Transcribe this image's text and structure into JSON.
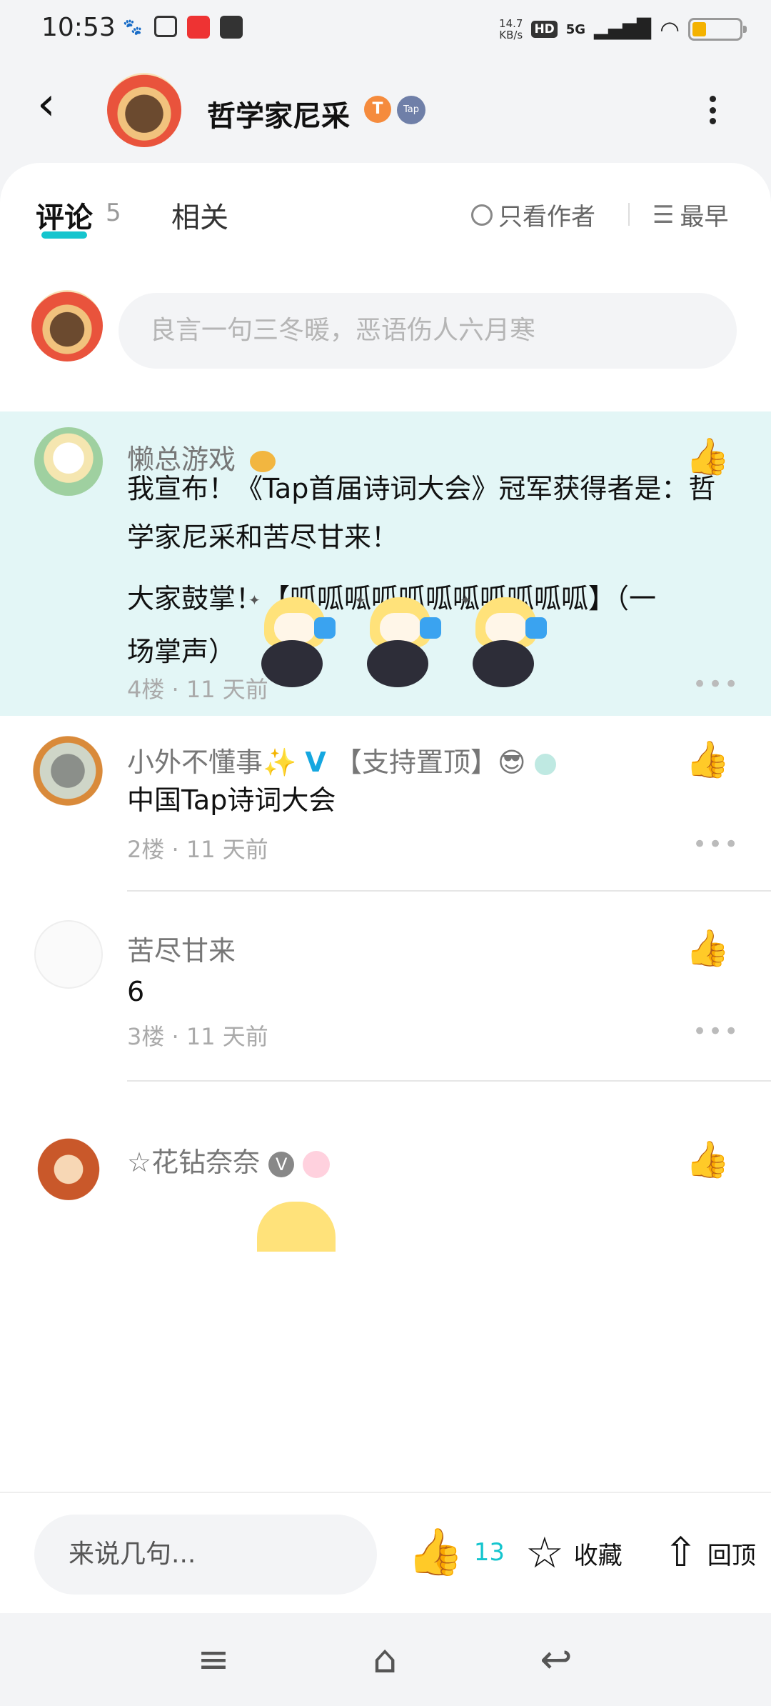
{
  "status_bar": {
    "time": "10:53",
    "net_speed_value": "14.7",
    "net_speed_unit": "KB/s",
    "hd": "HD",
    "signal": "5G",
    "app_icons": [
      "baidu-icon",
      "bilibili-icon",
      "news-app-icon",
      "mail-app-icon"
    ],
    "battery_level": 0.3
  },
  "header": {
    "title": "哲学家尼采",
    "badge1": "T",
    "badge2": "Tap"
  },
  "tabs": {
    "comments_label": "评论",
    "comments_count": "5",
    "related_label": "相关",
    "author_only_label": "只看作者",
    "sort_label": "最早"
  },
  "compose": {
    "placeholder": "良言一句三冬暖，恶语伤人六月寒"
  },
  "comments": [
    {
      "user": "懒总游戏",
      "text_line1": "我宣布！《Tap首届诗词大会》冠军获得者是：哲学家尼采和苦尽甘来！",
      "text_line2": "大家鼓掌！【呱呱呱呱呱呱呱呱呱呱呱】（一",
      "text_line3": "场掌声）",
      "floor": "4楼",
      "time": "11 天前"
    },
    {
      "user": "小外不懂事✨",
      "user_suffix": "【支持置顶】😎",
      "text": "中国Tap诗词大会",
      "floor": "2楼",
      "time": "11 天前"
    },
    {
      "user": "苦尽甘来",
      "text": "6",
      "floor": "3楼",
      "time": "11 天前"
    },
    {
      "user": "☆花钻奈奈"
    }
  ],
  "bottom_bar": {
    "input_placeholder": "来说几句...",
    "like_count": "13",
    "favorite_label": "收藏",
    "top_label": "回顶"
  },
  "colors": {
    "accent": "#15c5ce",
    "highlight_bg": "#e3f6f6"
  }
}
